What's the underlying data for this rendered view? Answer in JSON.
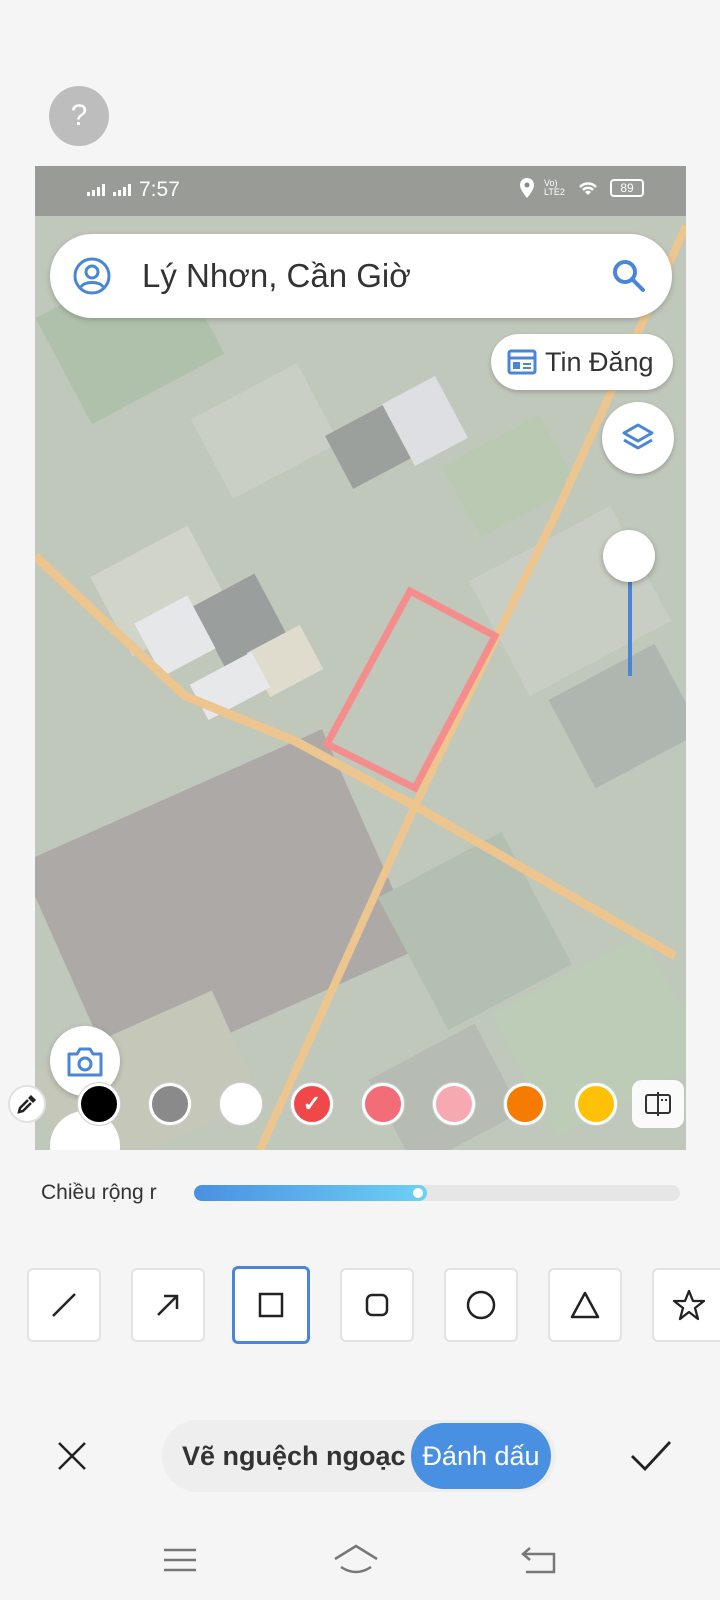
{
  "help": {
    "label": "?"
  },
  "map_screenshot": {
    "status_bar": {
      "time": "7:57",
      "battery": "89",
      "network": "Vo) LTE2"
    },
    "search": {
      "text": "Lý Nhơn, Cần Giờ"
    },
    "tin_dang": {
      "label": "Tin Đăng"
    }
  },
  "palette": {
    "colors": [
      "#000000",
      "#8a8a8a",
      "#ffffff",
      "#f04848",
      "#f26d78",
      "#f6a9b1",
      "#f57c00",
      "#ffc107"
    ],
    "selected_index": 3
  },
  "stroke_width": {
    "label": "Chiều rộng r",
    "level": 0.48
  },
  "shapes": {
    "items": [
      "line",
      "arrow",
      "rectangle",
      "rounded-rectangle",
      "circle",
      "triangle",
      "star"
    ],
    "selected": "rectangle"
  },
  "mode": {
    "draw_label": "Vẽ nguệch ngoạc",
    "mark_label": "Đánh dấu",
    "active": "mark"
  },
  "colors": {
    "accent": "#4a90e2",
    "highlight": "#f04848",
    "road": "#e3a24b"
  }
}
